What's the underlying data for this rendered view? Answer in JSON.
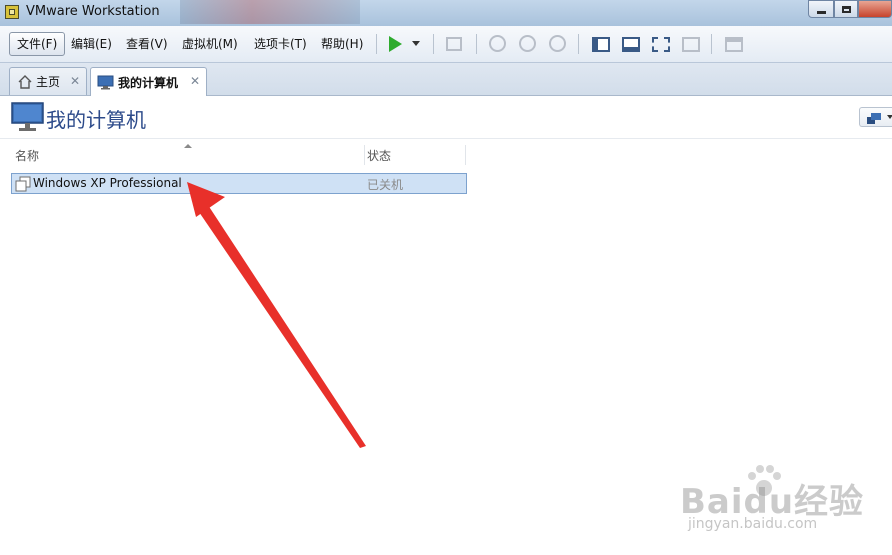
{
  "window": {
    "title": "VMware Workstation"
  },
  "menu": {
    "items": [
      {
        "id": "file",
        "label": "文件(F)"
      },
      {
        "id": "edit",
        "label": "编辑(E)"
      },
      {
        "id": "view",
        "label": "查看(V)"
      },
      {
        "id": "vm",
        "label": "虚拟机(M)"
      },
      {
        "id": "tabs",
        "label": "选项卡(T)"
      },
      {
        "id": "help",
        "label": "帮助(H)"
      }
    ]
  },
  "toolbar": {
    "icons": [
      "play-icon",
      "dropdown-arrow-icon",
      "send-ctrl-alt-del-icon",
      "snapshot-take-icon",
      "snapshot-revert-icon",
      "snapshot-manager-icon",
      "show-library-icon",
      "console-view-icon",
      "full-screen-icon",
      "unity-icon",
      "thumbnail-icon"
    ],
    "play_color": "#2eab2e"
  },
  "tabs": [
    {
      "id": "home",
      "label": "主页",
      "icon": "home-icon",
      "close": "✕"
    },
    {
      "id": "mycomputer",
      "label": "我的计算机",
      "icon": "computer-icon",
      "close": "✕",
      "active": true
    }
  ],
  "header": {
    "title": "我的计算机",
    "icon": "computer-monitor-icon"
  },
  "table": {
    "columns": [
      "名称",
      "状态"
    ],
    "rows": [
      {
        "name": "Windows XP Professional",
        "status": "已关机",
        "selected": true
      }
    ]
  },
  "watermark": {
    "brand": "Baidu经验",
    "url": "jingyan.baidu.com"
  },
  "colors": {
    "title_text": "#2c4a8a",
    "selection": "#cfe1f5",
    "annotation": "#e8302a"
  }
}
